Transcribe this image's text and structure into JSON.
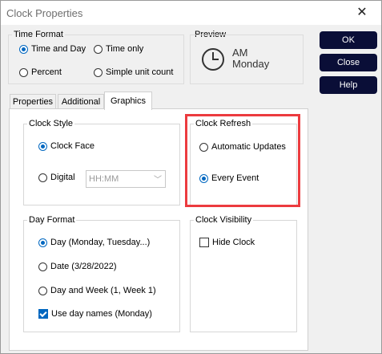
{
  "window": {
    "title": "Clock Properties",
    "close_glyph": "✕"
  },
  "buttons": {
    "ok": "OK",
    "close": "Close",
    "help": "Help"
  },
  "time_format": {
    "legend": "Time Format",
    "options": [
      "Time and Day",
      "Time only",
      "Percent",
      "Simple unit count"
    ],
    "selected": "Time and Day"
  },
  "preview": {
    "legend": "Preview",
    "line1": "AM",
    "line2": "Monday"
  },
  "tabs": [
    "Properties",
    "Additional",
    "Graphics"
  ],
  "active_tab": "Graphics",
  "clock_style": {
    "legend": "Clock Style",
    "options": [
      "Clock Face",
      "Digital"
    ],
    "selected": "Clock Face",
    "digital_format": "HH:MM",
    "dropdown_glyph": "﹀"
  },
  "clock_refresh": {
    "legend": "Clock Refresh",
    "options": [
      "Automatic Updates",
      "Every Event"
    ],
    "selected": "Every Event",
    "highlight_color": "#ec3b3f"
  },
  "day_format": {
    "legend": "Day Format",
    "options": [
      "Day (Monday, Tuesday...)",
      "Date (3/28/2022)",
      "Day and Week (1, Week 1)"
    ],
    "selected": "Day (Monday, Tuesday...)",
    "use_day_names_label": "Use day names (Monday)",
    "use_day_names_checked": true
  },
  "clock_visibility": {
    "legend": "Clock Visibility",
    "hide_clock_label": "Hide Clock",
    "hide_clock_checked": false
  },
  "colors": {
    "accent": "#0067c0",
    "button_bg": "#0a0e37"
  }
}
